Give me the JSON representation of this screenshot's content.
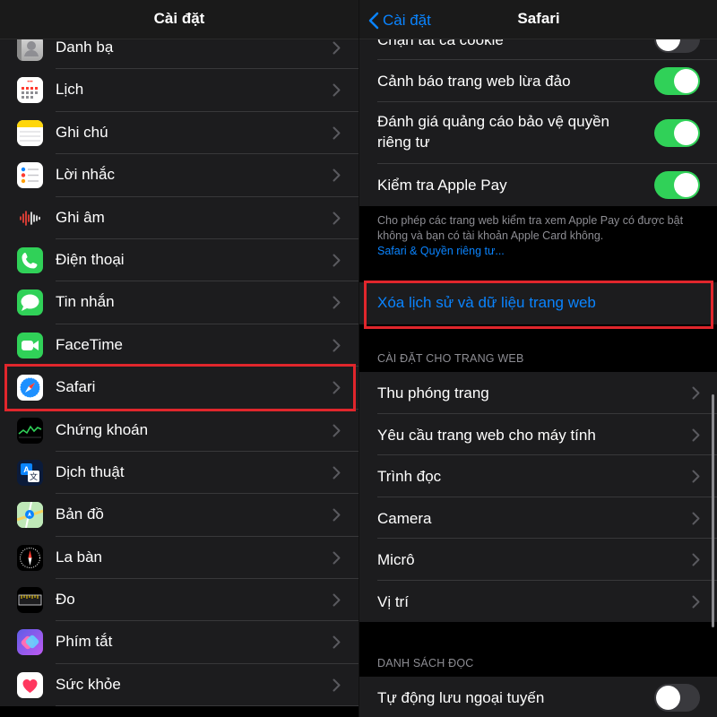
{
  "left": {
    "title": "Cài đặt",
    "items": [
      {
        "label": "Danh bạ",
        "icon": "contacts-icon"
      },
      {
        "label": "Lịch",
        "icon": "calendar-icon"
      },
      {
        "label": "Ghi chú",
        "icon": "notes-icon"
      },
      {
        "label": "Lời nhắc",
        "icon": "reminders-icon"
      },
      {
        "label": "Ghi âm",
        "icon": "voice-memos-icon"
      },
      {
        "label": "Điện thoại",
        "icon": "phone-icon"
      },
      {
        "label": "Tin nhắn",
        "icon": "messages-icon"
      },
      {
        "label": "FaceTime",
        "icon": "facetime-icon"
      },
      {
        "label": "Safari",
        "icon": "safari-icon"
      },
      {
        "label": "Chứng khoán",
        "icon": "stocks-icon"
      },
      {
        "label": "Dịch thuật",
        "icon": "translate-icon"
      },
      {
        "label": "Bản đồ",
        "icon": "maps-icon"
      },
      {
        "label": "La bàn",
        "icon": "compass-icon"
      },
      {
        "label": "Đo",
        "icon": "measure-icon"
      },
      {
        "label": "Phím tắt",
        "icon": "shortcuts-icon"
      },
      {
        "label": "Sức khỏe",
        "icon": "health-icon"
      }
    ]
  },
  "right": {
    "back_label": "Cài đặt",
    "title": "Safari",
    "privacy_rows": [
      {
        "label": "Chặn tất cả cookie",
        "toggle": "off"
      },
      {
        "label": "Cảnh báo trang web lừa đảo",
        "toggle": "on"
      },
      {
        "label": "Đánh giá quảng cáo bảo vệ quyền riêng tư",
        "toggle": "on"
      },
      {
        "label": "Kiểm tra Apple Pay",
        "toggle": "on"
      }
    ],
    "footer_text": "Cho phép các trang web kiểm tra xem Apple Pay có được bật không và bạn có tài khoản Apple Card không.",
    "footer_link": "Safari & Quyền riêng tư...",
    "clear_history_label": "Xóa lịch sử và dữ liệu trang web",
    "website_settings_header": "CÀI ĐẶT CHO TRANG WEB",
    "website_settings": [
      {
        "label": "Thu phóng trang"
      },
      {
        "label": "Yêu cầu trang web cho máy tính"
      },
      {
        "label": "Trình đọc"
      },
      {
        "label": "Camera"
      },
      {
        "label": "Micrô"
      },
      {
        "label": "Vị trí"
      }
    ],
    "reading_list_header": "DANH SÁCH ĐỌC",
    "reading_list_rows": [
      {
        "label": "Tự động lưu ngoại tuyến",
        "toggle": "off"
      }
    ]
  },
  "colors": {
    "accent": "#0a84ff",
    "toggle_on": "#30d158",
    "highlight": "#e0262c"
  }
}
